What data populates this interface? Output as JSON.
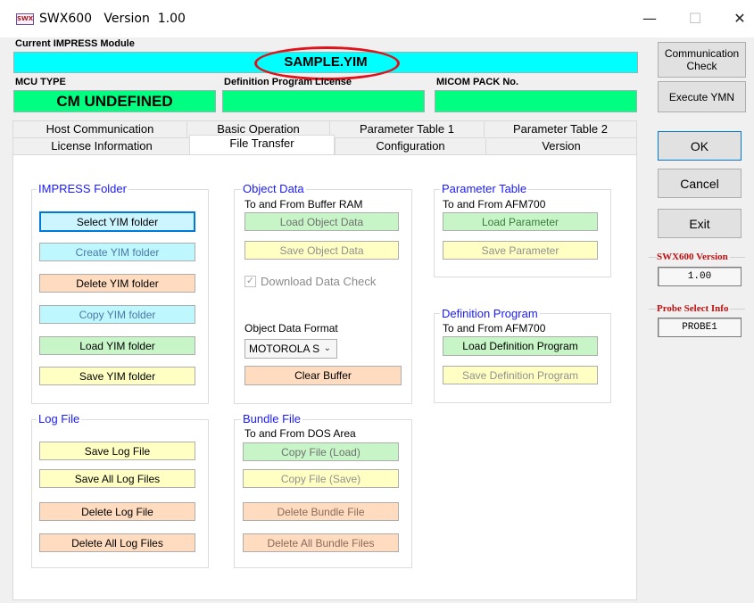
{
  "window": {
    "icon_text": "SWX",
    "title": "SWX600   Version  1.00",
    "minimize": "—",
    "maximize": "☐",
    "close": "✕"
  },
  "module": {
    "label": "Current IMPRESS Module",
    "value": "SAMPLE.YIM"
  },
  "mcu": {
    "label": "MCU TYPE",
    "value": "CM UNDEFINED"
  },
  "definition_license": {
    "label": "Definition Program License",
    "value": ""
  },
  "micom_pack": {
    "label": "MICOM PACK No.",
    "value": ""
  },
  "side": {
    "communication_check": "Communication Check",
    "execute_ymn": "Execute YMN",
    "ok": "OK",
    "cancel": "Cancel",
    "exit": "Exit",
    "swx_version_label": "SWX600 Version",
    "swx_version_value": "1.00",
    "probe_label": "Probe Select Info",
    "probe_value": "PROBE1"
  },
  "tabs": {
    "row1": [
      "Host Communication",
      "Basic Operation",
      "Parameter Table 1",
      "Parameter Table 2"
    ],
    "row2": [
      "License Information",
      "File Transfer",
      "Configuration",
      "Version"
    ],
    "active": "File Transfer"
  },
  "impress_folder": {
    "title": "IMPRESS Folder",
    "buttons": [
      "Select YIM folder",
      "Create YIM folder",
      "Delete YIM folder",
      "Copy YIM folder",
      "Load YIM folder",
      "Save YIM folder"
    ]
  },
  "object_data": {
    "title": "Object Data",
    "subtitle": "To and From Buffer RAM",
    "load": "Load Object Data",
    "save": "Save Object Data",
    "download_check": "Download Data Check",
    "format_label": "Object Data Format",
    "format_value": "MOTOROLA S",
    "clear_buffer": "Clear Buffer"
  },
  "parameter_table": {
    "title": "Parameter Table",
    "subtitle": "To and From AFM700",
    "load": "Load Parameter",
    "save": "Save Parameter"
  },
  "definition_program": {
    "title": "Definition Program",
    "subtitle": "To and From AFM700",
    "load": "Load Definition Program",
    "save": "Save Definition Program"
  },
  "log_file": {
    "title": "Log File",
    "buttons": [
      "Save Log File",
      "Save All Log Files",
      "Delete Log File",
      "Delete All Log Files"
    ]
  },
  "bundle_file": {
    "title": "Bundle File",
    "subtitle": "To and From DOS Area",
    "buttons": [
      "Copy File (Load)",
      "Copy File (Save)",
      "Delete Bundle File",
      "Delete All Bundle Files"
    ]
  }
}
